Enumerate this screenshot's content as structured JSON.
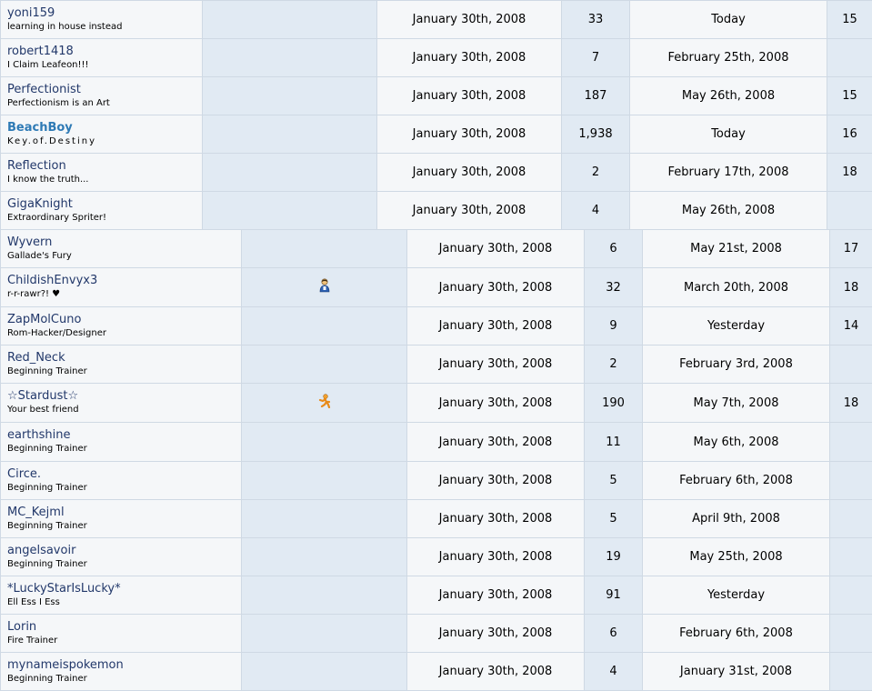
{
  "groups": [
    {
      "rows": [
        {
          "username": "yoni159",
          "usertitle": "learning in house instead",
          "join_date": "January 30th, 2008",
          "posts": "33",
          "last_visit": "Today",
          "age": "15"
        },
        {
          "username": "robert1418",
          "usertitle": "I Claim Leafeon!!!",
          "join_date": "January 30th, 2008",
          "posts": "7",
          "last_visit": "February 25th, 2008",
          "age": ""
        },
        {
          "username": "Perfectionist",
          "usertitle": "Perfectionism is an Art",
          "join_date": "January 30th, 2008",
          "posts": "187",
          "last_visit": "May 26th, 2008",
          "age": "15"
        },
        {
          "username": "BeachBoy",
          "usertitle": "Key.of.Destiny",
          "join_date": "January 30th, 2008",
          "posts": "1,938",
          "last_visit": "Today",
          "age": "16",
          "bold": true
        },
        {
          "username": "Reflection",
          "usertitle": "I know the truth...",
          "join_date": "January 30th, 2008",
          "posts": "2",
          "last_visit": "February 17th, 2008",
          "age": "18"
        },
        {
          "username": "GigaKnight",
          "usertitle": "Extraordinary Spriter!",
          "join_date": "January 30th, 2008",
          "posts": "4",
          "last_visit": "May 26th, 2008",
          "age": ""
        }
      ]
    },
    {
      "rows": [
        {
          "username": "Wyvern",
          "usertitle": "Gallade's Fury",
          "join_date": "January 30th, 2008",
          "posts": "6",
          "last_visit": "May 21st, 2008",
          "age": "17"
        },
        {
          "username": "ChildishEnvyx3",
          "usertitle": "r-r-rawr?! ♥",
          "join_date": "January 30th, 2008",
          "posts": "32",
          "last_visit": "March 20th, 2008",
          "age": "18",
          "im_icon": "aim-buddy-icon"
        },
        {
          "username": "ZapMolCuno",
          "usertitle": "Rom-Hacker/Designer",
          "join_date": "January 30th, 2008",
          "posts": "9",
          "last_visit": "Yesterday",
          "age": "14"
        },
        {
          "username": "Red_Neck",
          "usertitle": "Beginning Trainer",
          "join_date": "January 30th, 2008",
          "posts": "2",
          "last_visit": "February 3rd, 2008",
          "age": ""
        },
        {
          "username": "☆Stardust☆",
          "usertitle": "Your best friend",
          "join_date": "January 30th, 2008",
          "posts": "190",
          "last_visit": "May 7th, 2008",
          "age": "18",
          "im_icon": "aim-running-man-icon"
        },
        {
          "username": "earthshine",
          "usertitle": "Beginning Trainer",
          "join_date": "January 30th, 2008",
          "posts": "11",
          "last_visit": "May 6th, 2008",
          "age": ""
        },
        {
          "username": "Circe.",
          "usertitle": "Beginning Trainer",
          "join_date": "January 30th, 2008",
          "posts": "5",
          "last_visit": "February 6th, 2008",
          "age": ""
        },
        {
          "username": "MC_Kejml",
          "usertitle": "Beginning Trainer",
          "join_date": "January 30th, 2008",
          "posts": "5",
          "last_visit": "April 9th, 2008",
          "age": ""
        },
        {
          "username": "angelsavoir",
          "usertitle": "Beginning Trainer",
          "join_date": "January 30th, 2008",
          "posts": "19",
          "last_visit": "May 25th, 2008",
          "age": ""
        },
        {
          "username": "*LuckyStarIsLucky*",
          "usertitle": "Ell Ess I Ess",
          "join_date": "January 30th, 2008",
          "posts": "91",
          "last_visit": "Yesterday",
          "age": ""
        },
        {
          "username": "Lorin",
          "usertitle": "Fire Trainer",
          "join_date": "January 30th, 2008",
          "posts": "6",
          "last_visit": "February 6th, 2008",
          "age": ""
        },
        {
          "username": "mynameispokemon",
          "usertitle": "Beginning Trainer",
          "join_date": "January 30th, 2008",
          "posts": "4",
          "last_visit": "January 31st, 2008",
          "age": ""
        }
      ]
    }
  ],
  "colors": {
    "cell_light": "#f5f7f9",
    "cell_dark": "#e1eaf3",
    "border": "#cfd9e4",
    "username": "#22386a",
    "username_bold": "#2e7ab5"
  }
}
